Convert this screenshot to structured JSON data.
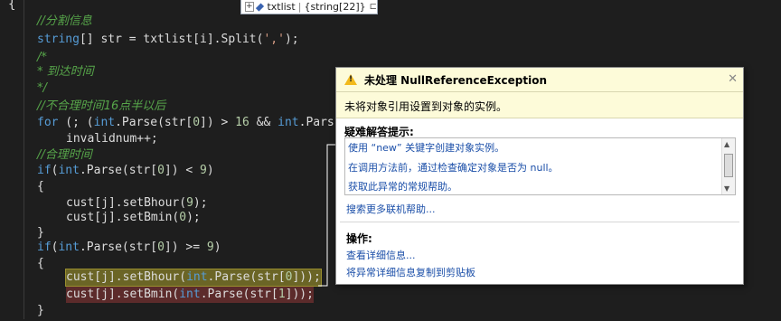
{
  "editor": {
    "brace_top": "{",
    "lines": [
      {
        "t": "//分割信息"
      },
      {
        "t": "string[] str = txtlist[i].Split(',');"
      },
      {
        "t": "/*"
      },
      {
        "t": "* 到达时间"
      },
      {
        "t": "*/"
      },
      {
        "t": "//不合理时间16点半以后"
      },
      {
        "t": "for (; (int.Parse(str[0]) > 16 && int.Pars"
      },
      {
        "t": "invalidnum++;"
      },
      {
        "t": "//合理时间"
      },
      {
        "t": "if(int.Parse(str[0]) < 9)"
      },
      {
        "t": "{"
      },
      {
        "t": "cust[j].setBhour(9);"
      },
      {
        "t": "cust[j].setBmin(0);"
      },
      {
        "t": "}"
      },
      {
        "t": "if(int.Parse(str[0]) >= 9)"
      },
      {
        "t": "{"
      },
      {
        "t": "cust[j].setBhour(int.Parse(str[0]));"
      },
      {
        "t": "cust[j].setBmin(int.Parse(str[1]));"
      },
      {
        "t": "}"
      }
    ]
  },
  "datatip": {
    "expand": "+",
    "name": "txtlist",
    "value": "{string[22]}",
    "pin_icon": "pin-icon"
  },
  "exception": {
    "title": "未处理 NullReferenceException",
    "close": "✕",
    "message": "未将对象引用设置到对象的实例。",
    "tips_header": "疑难解答提示:",
    "tips": [
      "使用 “new” 关键字创建对象实例。",
      "在调用方法前，通过检查确定对象是否为 null。",
      "获取此异常的常规帮助。"
    ],
    "search_link": "搜索更多联机帮助...",
    "actions_header": "操作:",
    "actions": [
      "查看详细信息...",
      "将异常详细信息复制到剪贴板"
    ],
    "accent_color": "#f2b91b",
    "link_color": "#1a4ea8"
  }
}
